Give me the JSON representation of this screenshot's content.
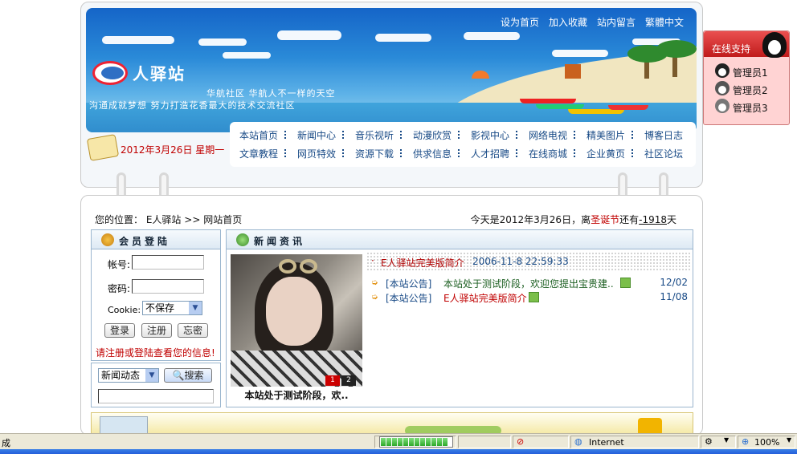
{
  "site": {
    "logo_text": "人驿站",
    "slogan1": "华航社区  华航人不一样的天空",
    "slogan2": "沟通成就梦想  努力打造花香最大的技术交流社区",
    "top_links": [
      "设为首页",
      "加入收藏",
      "站内留言",
      "繁體中文"
    ],
    "date_text": "2012年3月26日  星期一"
  },
  "nav": {
    "row1": [
      "本站首页",
      "新闻中心",
      "音乐视听",
      "动漫欣赏",
      "影视中心",
      "网络电视",
      "精美图片",
      "博客日志"
    ],
    "row2": [
      "文章教程",
      "网页特效",
      "资源下载",
      "供求信息",
      "人才招聘",
      "在线商城",
      "企业黄页",
      "社区论坛"
    ]
  },
  "breadcrumb": {
    "prefix": "您的位置：",
    "home": "E人驿站",
    "sep": ">>",
    "current": "网站首页"
  },
  "today": {
    "pre": "今天是2012年3月26日，离",
    "festival": "圣诞节",
    "mid": "还有",
    "days": "-1918",
    "post": "天"
  },
  "login": {
    "title": "会员登陆",
    "account_label": "帐号:",
    "password_label": "密码:",
    "cookie_label": "Cookie:",
    "cookie_value": "不保存",
    "login_btn": "登录",
    "register_btn": "注册",
    "forgot_btn": "忘密",
    "notice": "请注册或登陆查看您的信息!"
  },
  "search": {
    "category": "新闻动态",
    "button": "搜索",
    "query": ""
  },
  "news": {
    "title": "新闻资讯",
    "image_caption": "本站处于测试阶段，欢..",
    "pages": [
      "1",
      "2"
    ],
    "headline_title": "E人驿站完美版简介",
    "headline_date": "2006-11-8 22:59:33",
    "items": [
      {
        "tag": "[本站公告]",
        "title": "本站处于测试阶段，欢迎您提出宝贵建..",
        "date": "12/02"
      },
      {
        "tag": "[本站公告]",
        "title": "E人驿站完美版简介",
        "date": "11/08"
      }
    ]
  },
  "qq": {
    "title": "在线支持",
    "admins": [
      "管理员1",
      "管理员2",
      "管理员3"
    ]
  },
  "statusbar": {
    "left": "成",
    "zone": "Internet",
    "zoom": "100%",
    "progress_fraction": 1.0
  },
  "colors": {
    "nav_text": "#184a86",
    "date_red": "#c00000",
    "accent": "#1565c8"
  }
}
